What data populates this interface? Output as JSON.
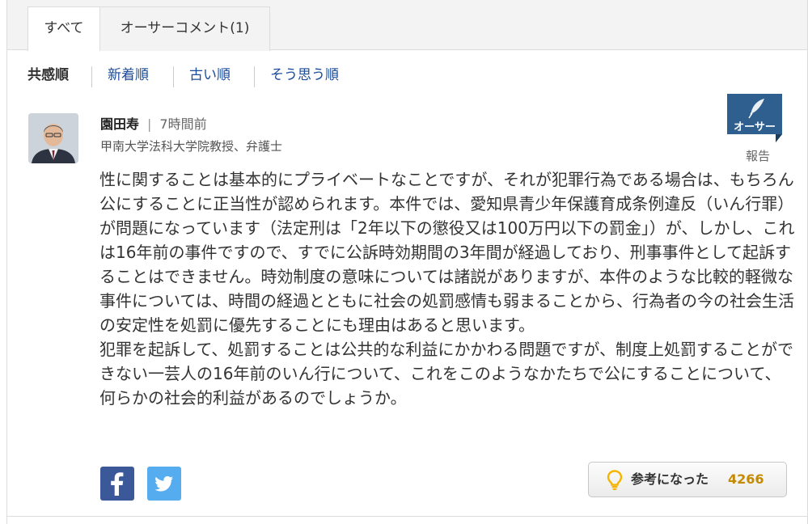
{
  "tabs": [
    {
      "label": "すべて",
      "active": true
    },
    {
      "label": "オーサーコメント(1)",
      "active": false
    }
  ],
  "sort": {
    "current": "共感順",
    "options": [
      "新着順",
      "古い順",
      "そう思う順"
    ]
  },
  "comment": {
    "author_name": "園田寿",
    "meta_separator": "|",
    "time": "7時間前",
    "author_title": "甲南大学法科大学院教授、弁護士",
    "badge_label": "オーサー",
    "report_label": "報告",
    "body_paragraph_1": "性に関することは基本的にプライベートなことですが、それが犯罪行為である場合は、もちろん公にすることに正当性が認められます。本件では、愛知県青少年保護育成条例違反（いん行罪）が問題になっています（法定刑は「2年以下の懲役又は100万円以下の罰金」）が、しかし、これは16年前の事件ですので、すでに公訴時効期間の3年間が経過しており、刑事事件として起訴することはできません。時効制度の意味については諸説がありますが、本件のような比較的軽微な事件については、時間の経過とともに社会の処罰感情も弱まることから、行為者の今の社会生活の安定性を処罰に優先することにも理由はあると思います。",
    "body_paragraph_2": "犯罪を起訴して、処罰することは公共的な利益にかかわる問題ですが、制度上処罰することができない一芸人の16年前のいん行について、これをこのようなかたちで公にすることについて、何らかの社会的利益があるのでしょうか。",
    "helpful_label": "参考になった",
    "helpful_count": "4266"
  },
  "icons": {
    "facebook": "facebook-icon",
    "twitter": "twitter-icon",
    "bulb": "lightbulb-icon",
    "badge": "quill-pen-icon"
  },
  "colors": {
    "link": "#1b4c9b",
    "badge": "#2f5f8f",
    "facebook": "#3b5998",
    "twitter": "#55acee",
    "count": "#c58a00",
    "bulb": "#f5b400"
  }
}
